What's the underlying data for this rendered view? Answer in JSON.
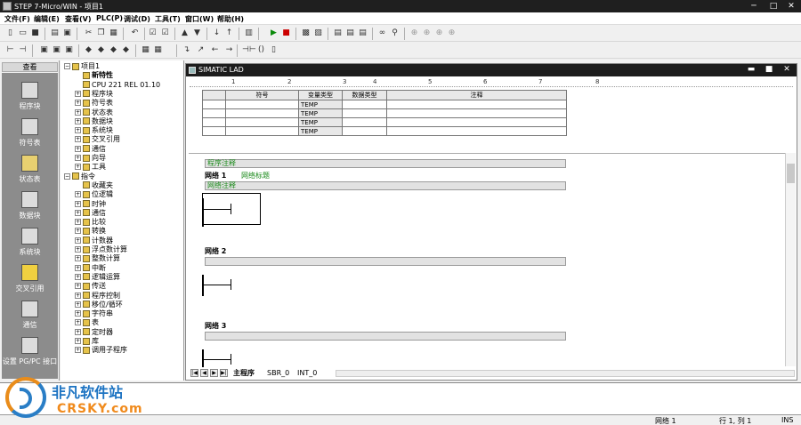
{
  "window": {
    "title": "STEP 7-Micro/WIN - 项目1"
  },
  "menu": [
    "文件(F)",
    "编辑(E)",
    "查看(V)",
    "PLC(P)",
    "调试(D)",
    "工具(T)",
    "窗口(W)",
    "帮助(H)"
  ],
  "nav": {
    "header": "查看",
    "items": [
      "程序块",
      "符号表",
      "状态表",
      "数据块",
      "系统块",
      "交叉引用",
      "通信",
      "设置 PG/PC 接口"
    ]
  },
  "tree": {
    "rows": [
      {
        "label": "项目1",
        "level": 0,
        "expander": "−"
      },
      {
        "label": "新特性",
        "level": 1,
        "expander": "",
        "bold": true
      },
      {
        "label": "CPU 221 REL 01.10",
        "level": 1,
        "expander": ""
      },
      {
        "label": "程序块",
        "level": 1,
        "expander": "+"
      },
      {
        "label": "符号表",
        "level": 1,
        "expander": "+"
      },
      {
        "label": "状态表",
        "level": 1,
        "expander": "+"
      },
      {
        "label": "数据块",
        "level": 1,
        "expander": "+"
      },
      {
        "label": "系统块",
        "level": 1,
        "expander": "+"
      },
      {
        "label": "交叉引用",
        "level": 1,
        "expander": "+"
      },
      {
        "label": "通信",
        "level": 1,
        "expander": "+"
      },
      {
        "label": "向导",
        "level": 1,
        "expander": "+"
      },
      {
        "label": "工具",
        "level": 1,
        "expander": "+"
      },
      {
        "label": "指令",
        "level": 0,
        "expander": "−"
      },
      {
        "label": "收藏夹",
        "level": 1,
        "expander": ""
      },
      {
        "label": "位逻辑",
        "level": 1,
        "expander": "+"
      },
      {
        "label": "时钟",
        "level": 1,
        "expander": "+"
      },
      {
        "label": "通信",
        "level": 1,
        "expander": "+"
      },
      {
        "label": "比较",
        "level": 1,
        "expander": "+"
      },
      {
        "label": "转换",
        "level": 1,
        "expander": "+"
      },
      {
        "label": "计数器",
        "level": 1,
        "expander": "+"
      },
      {
        "label": "浮点数计算",
        "level": 1,
        "expander": "+"
      },
      {
        "label": "整数计算",
        "level": 1,
        "expander": "+"
      },
      {
        "label": "中断",
        "level": 1,
        "expander": "+"
      },
      {
        "label": "逻辑运算",
        "level": 1,
        "expander": "+"
      },
      {
        "label": "传送",
        "level": 1,
        "expander": "+"
      },
      {
        "label": "程序控制",
        "level": 1,
        "expander": "+"
      },
      {
        "label": "移位/循环",
        "level": 1,
        "expander": "+"
      },
      {
        "label": "字符串",
        "level": 1,
        "expander": "+"
      },
      {
        "label": "表",
        "level": 1,
        "expander": "+"
      },
      {
        "label": "定时器",
        "level": 1,
        "expander": "+"
      },
      {
        "label": "库",
        "level": 1,
        "expander": "+"
      },
      {
        "label": "调用子程序",
        "level": 1,
        "expander": "+"
      }
    ]
  },
  "editor": {
    "title": "SIMATIC LAD",
    "ruler": [
      "1",
      "2",
      "3",
      "4",
      "5",
      "6",
      "7",
      "8"
    ],
    "var_table": {
      "headers": [
        "符号",
        "变量类型",
        "数据类型",
        "注释"
      ],
      "rows": [
        "TEMP",
        "TEMP",
        "TEMP",
        "TEMP"
      ]
    },
    "program_comment": "程序注释",
    "networks": [
      {
        "label": "网络 1",
        "title": "网络标题",
        "comment": "网络注释"
      },
      {
        "label": "网络 2",
        "title": "",
        "comment": ""
      },
      {
        "label": "网络 3",
        "title": "",
        "comment": ""
      }
    ],
    "tabs": [
      "主程序",
      "SBR_0",
      "INT_0"
    ]
  },
  "status": {
    "network": "网络 1",
    "position": "行 1, 列 1",
    "mode": "INS"
  },
  "watermark": {
    "cn": "非凡软件站",
    "en": "CRSKY.com"
  }
}
